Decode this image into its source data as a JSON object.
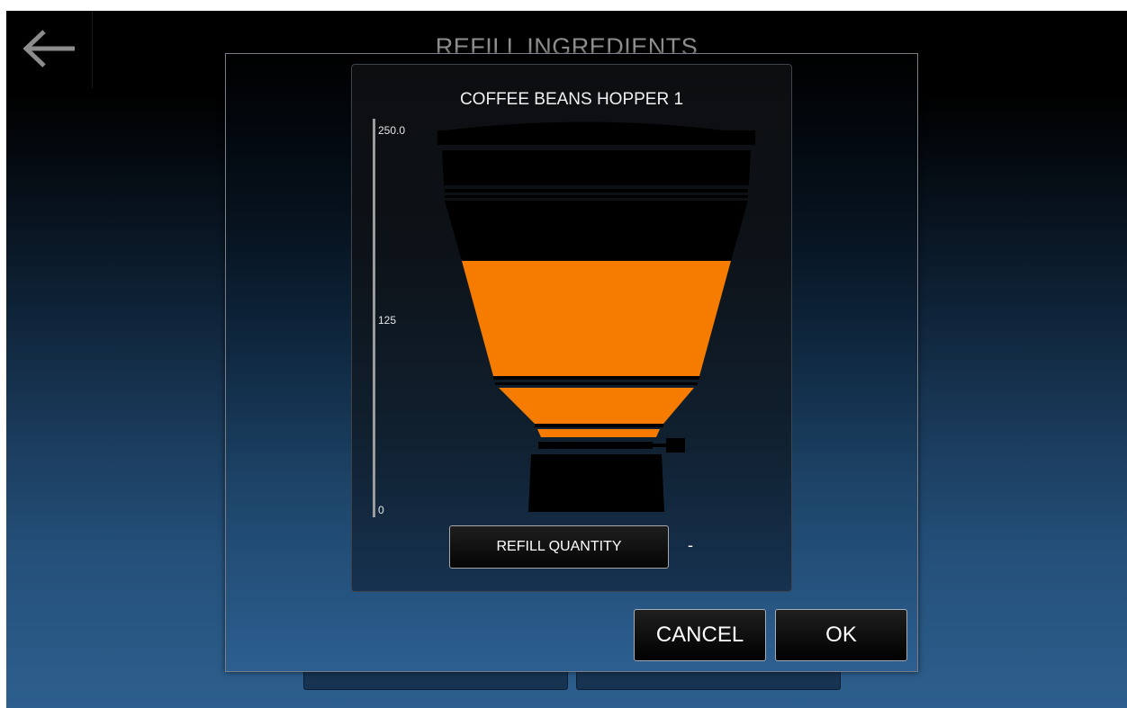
{
  "header": {
    "title": "REFILL INGREDIENTS"
  },
  "dialog": {
    "hopper_title": "COFFEE BEANS HOPPER 1",
    "scale": {
      "max_label": "250.0",
      "mid_label": "125",
      "min_label": "0"
    },
    "fill_color": "#f57c00",
    "refill_button_label": "REFILL QUANTITY",
    "refill_value": "-",
    "cancel_label": "CANCEL",
    "ok_label": "OK"
  },
  "icons": {
    "back": "left-arrow-icon"
  }
}
